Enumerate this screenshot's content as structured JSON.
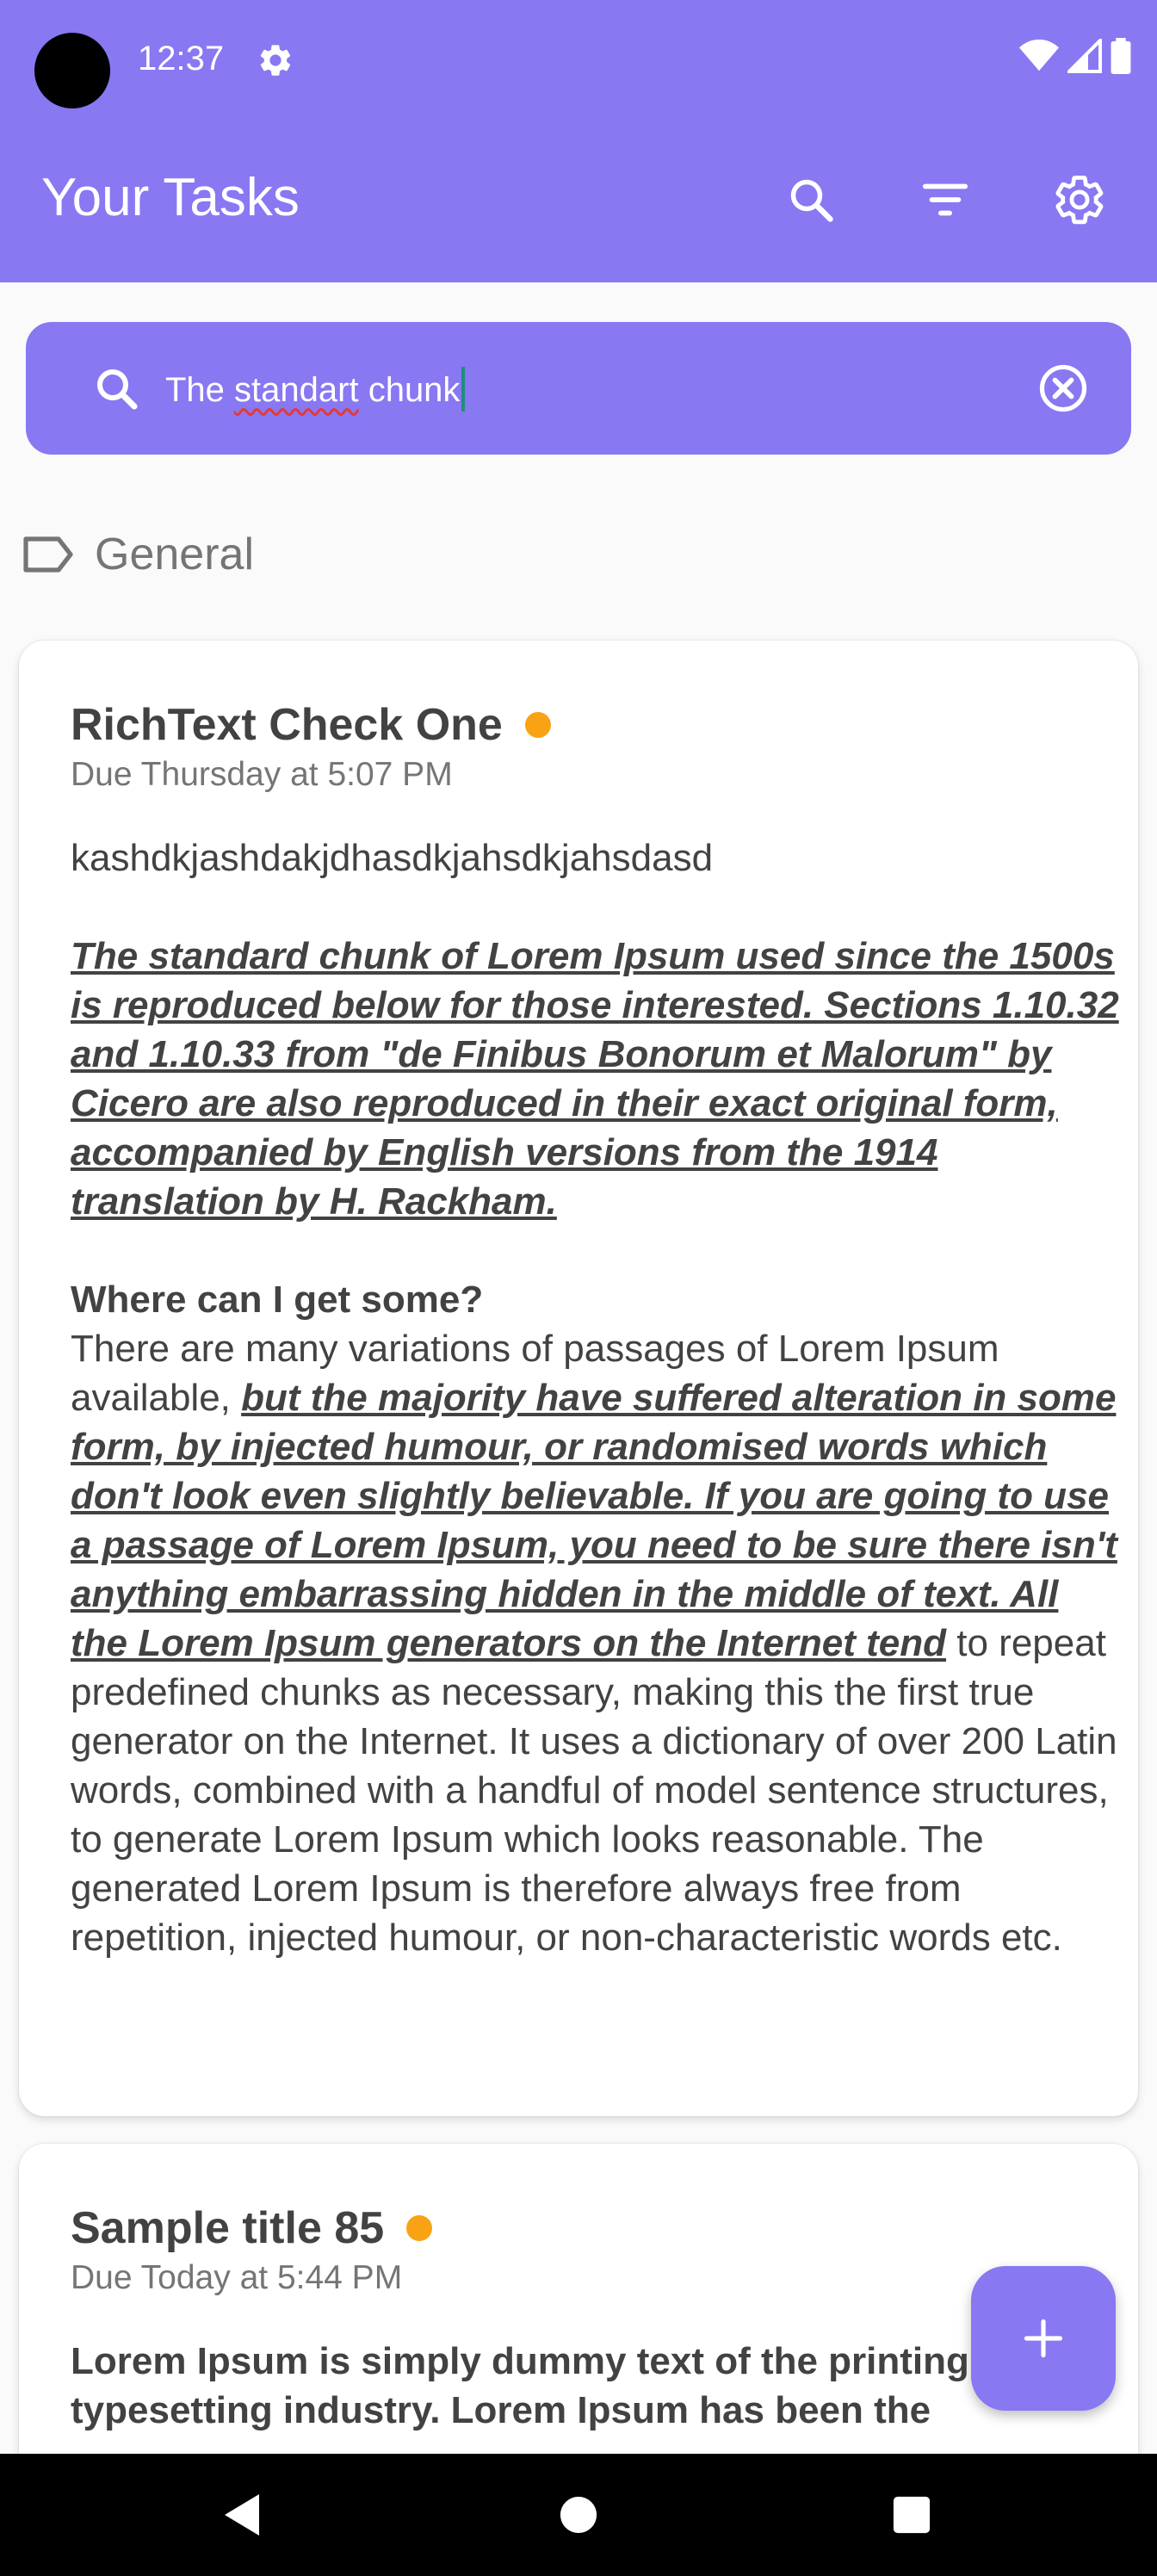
{
  "status_bar": {
    "time": "12:37"
  },
  "app_bar": {
    "title": "Your Tasks"
  },
  "search": {
    "query_plain": "The ",
    "query_misspelled": "standart",
    "query_rest": " chunk"
  },
  "section": {
    "label": "General"
  },
  "tasks": [
    {
      "title": "RichText Check One",
      "due": "Due Thursday at 5:07 PM",
      "line1": "kashdkjashdakjdhasdkjahsdkjahsdasd",
      "para1": "The standard chunk of Lorem Ipsum used since the 1500s is reproduced below for those interested. Sections 1.10.32 and 1.10.33 from \"de Finibus Bonorum et Malorum\" by Cicero are also reproduced in their exact original form, accompanied by English versions from the 1914 translation by H. Rackham.",
      "heading": "Where can I get some?",
      "para2_a": "There are many variations of passages of Lorem Ipsum available, ",
      "para2_b": "but the majority have suffered alteration in some form, by injected humour, or randomised words which don't look even slightly believable. If you are going to use a passage of Lorem Ipsum, you need to be sure there isn't anything embarrassing hidden in the middle of text. All the Lorem Ipsum generators on the Internet tend",
      "para2_c": " to repeat predefined chunks as necessary, making this the first true generator on the Internet. It uses a dictionary of over 200 Latin words, combined with a handful of model sentence structures, to generate Lorem Ipsum which looks reasonable. The generated Lorem Ipsum is therefore always free from repetition, injected humour, or non-characteristic words etc."
    },
    {
      "title": "Sample title 85",
      "due": "Due Today at 5:44 PM",
      "body": "Lorem Ipsum is simply dummy text of the printing and typesetting industry. Lorem Ipsum has been the"
    }
  ],
  "colors": {
    "accent": "#8878f2",
    "priority_dot": "#f9a213"
  }
}
